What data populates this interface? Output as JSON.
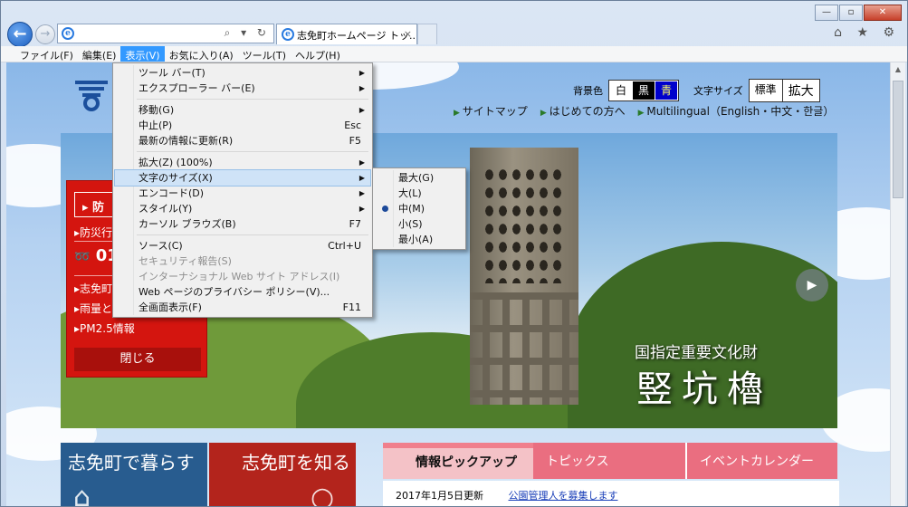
{
  "window": {
    "buttons": {
      "minimize": "—",
      "maximize": "▫",
      "close": "✕"
    }
  },
  "browser": {
    "search_glyphs": "⌕ ▾ ↻",
    "tab_title": "志免町ホームページ トッ...",
    "tab_close": "×",
    "right_icons": "⌂ ★ ⚙",
    "ie_glyph": "e",
    "back_glyph": "←",
    "forward_glyph": "→"
  },
  "menubar": [
    {
      "label": "ファイル(F)"
    },
    {
      "label": "編集(E)"
    },
    {
      "label": "表示(V)",
      "active": true
    },
    {
      "label": "お気に入り(A)"
    },
    {
      "label": "ツール(T)"
    },
    {
      "label": "ヘルプ(H)"
    }
  ],
  "view_menu": [
    {
      "label": "ツール バー(T)",
      "submenu": true
    },
    {
      "label": "エクスプローラー バー(E)",
      "submenu": true
    },
    {
      "sep": true
    },
    {
      "label": "移動(G)",
      "submenu": true
    },
    {
      "label": "中止(P)",
      "shortcut": "Esc"
    },
    {
      "label": "最新の情報に更新(R)",
      "shortcut": "F5"
    },
    {
      "sep": true
    },
    {
      "label": "拡大(Z) (100%)",
      "submenu": true
    },
    {
      "label": "文字のサイズ(X)",
      "submenu": true,
      "highlighted": true
    },
    {
      "label": "エンコード(D)",
      "submenu": true
    },
    {
      "label": "スタイル(Y)",
      "submenu": true
    },
    {
      "label": "カーソル ブラウズ(B)",
      "shortcut": "F7"
    },
    {
      "sep": true
    },
    {
      "label": "ソース(C)",
      "shortcut": "Ctrl+U"
    },
    {
      "label": "セキュリティ報告(S)",
      "disabled": true
    },
    {
      "label": "インターナショナル Web サイト アドレス(I)",
      "disabled": true
    },
    {
      "label": "Web ページのプライバシー ポリシー(V)..."
    },
    {
      "label": "全画面表示(F)",
      "shortcut": "F11"
    }
  ],
  "textsize_menu": [
    {
      "label": "最大(G)"
    },
    {
      "label": "大(L)"
    },
    {
      "label": "中(M)",
      "checked": true
    },
    {
      "label": "小(S)"
    },
    {
      "label": "最小(A)"
    }
  ],
  "site": {
    "bg_label": "背景色",
    "bg_options": [
      {
        "label": "白",
        "bg": "#ffffff",
        "fg": "#000000"
      },
      {
        "label": "黒",
        "bg": "#000000",
        "fg": "#ffffff"
      },
      {
        "label": "青",
        "bg": "#0000cc",
        "fg": "#ffff66"
      }
    ],
    "textsize_label": "文字サイズ",
    "textsize_std": "標準",
    "textsize_large": "拡大",
    "links": [
      "サイトマップ",
      "はじめての方へ",
      "Multilingual（English・中文・한글）"
    ],
    "hero_caption_small": "国指定重要文化財",
    "hero_caption_big": "竪坑櫓",
    "hero_next": "▶",
    "disaster": {
      "button": "▸ 防",
      "line1": "▸防災行",
      "phone": "01",
      "phone_icon": "➿",
      "item1": "▸志免町",
      "item2": "▸雨量と",
      "item3": "▸PM2.5情報",
      "close": "閉じる"
    },
    "block1": "志免町で暮らす",
    "block2": "志免町を知る",
    "tabs": [
      "情報ピックアップ",
      "トピックス",
      "イベントカレンダー"
    ],
    "news_date": "2017年1月5日更新",
    "news_link": "公園管理人を募集します"
  }
}
